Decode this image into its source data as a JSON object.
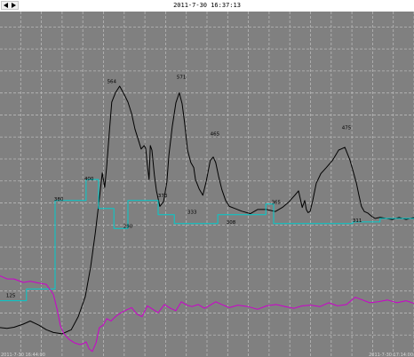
{
  "header": {
    "timestamp": "2011-7-30 16:37:13"
  },
  "chart_data": {
    "type": "line",
    "grid": true,
    "background_color": "#808080",
    "grid_color": "#b8b8b8",
    "xlim": [
      0,
      100
    ],
    "ylim": [
      0,
      100
    ],
    "x_start_label": "2011-7-30 16:44:00",
    "x_end_label": "2011-7-30 17:14:00",
    "series": [
      {
        "color": "#000000",
        "x": [
          0,
          1.7,
          3.4,
          5.6,
          7.3,
          9.4,
          11.2,
          12.9,
          15.0,
          17.2,
          18.9,
          20.6,
          21.9,
          23.0,
          24.0,
          24.7,
          25.3,
          25.8,
          26.4,
          27.0,
          27.9,
          28.9,
          30.0,
          30.9,
          31.8,
          32.6,
          33.3,
          34.1,
          34.8,
          35.2,
          35.6,
          36.0,
          36.3,
          36.7,
          37.3,
          37.8,
          38.6,
          39.5,
          40.3,
          40.8,
          41.6,
          42.5,
          43.3,
          44.0,
          44.6,
          45.3,
          46.1,
          46.8,
          47.2,
          48.1,
          49.0,
          49.8,
          50.8,
          51.5,
          52.1,
          52.8,
          53.6,
          54.5,
          55.4,
          56.7,
          58.4,
          60.5,
          62.2,
          64.4,
          66.5,
          68.2,
          69.7,
          71.2,
          72.1,
          73.0,
          73.6,
          74.0,
          74.4,
          74.9,
          75.5,
          76.4,
          77.5,
          78.8,
          80.3,
          81.8,
          83.3,
          84.5,
          85.4,
          86.1,
          86.7,
          87.3,
          88.0,
          88.8,
          89.7,
          90.6,
          91.8,
          93.3,
          94.8,
          96.4,
          98.1,
          100
        ],
        "y": [
          8.5,
          8.3,
          8.6,
          9.5,
          10.4,
          9.2,
          7.9,
          7.1,
          6.7,
          7.9,
          11.7,
          17.5,
          26.2,
          35.8,
          45.7,
          53.3,
          49.1,
          55.5,
          64.9,
          73.8,
          76.5,
          78.4,
          76.0,
          73.8,
          70.4,
          66.0,
          63.3,
          60.2,
          61.2,
          60.4,
          55.5,
          51.4,
          61.2,
          59.9,
          52.6,
          48.1,
          43.6,
          45.0,
          50.6,
          58.4,
          66.7,
          73.6,
          76.5,
          73.3,
          67.8,
          59.9,
          56.3,
          54.8,
          51.4,
          48.7,
          46.8,
          50.8,
          56.9,
          57.9,
          56.3,
          52.4,
          48.4,
          45.3,
          43.6,
          43.0,
          42.2,
          41.5,
          42.7,
          42.7,
          42.1,
          43.3,
          44.8,
          46.8,
          48.1,
          43.3,
          45.3,
          42.7,
          41.8,
          42.1,
          45.0,
          50.3,
          53.1,
          54.8,
          56.9,
          59.9,
          60.7,
          57.1,
          53.3,
          50.3,
          46.8,
          43.6,
          42.1,
          41.7,
          40.8,
          40.1,
          40.4,
          40.1,
          39.8,
          40.4,
          39.8,
          40.4
        ]
      },
      {
        "color": "#00cccc",
        "x": [
          0,
          6.4,
          6.4,
          13.3,
          13.3,
          20.8,
          20.8,
          23.8,
          23.8,
          27.5,
          27.5,
          30.9,
          30.9,
          38.2,
          38.2,
          42.1,
          42.1,
          52.6,
          52.6,
          64.2,
          64.2,
          66.1,
          66.1,
          85.2,
          85.2,
          91.8,
          91.8,
          100
        ],
        "y": [
          16.3,
          16.3,
          19.7,
          19.7,
          45.3,
          45.3,
          51.4,
          51.4,
          43.0,
          43.0,
          37.2,
          37.2,
          45.3,
          45.3,
          41.2,
          41.2,
          38.6,
          38.6,
          41.2,
          41.2,
          44.3,
          44.3,
          38.6,
          38.6,
          39.1,
          39.1,
          40.1,
          40.1
        ]
      },
      {
        "color": "#cc00cc",
        "x": [
          0,
          1.7,
          3.4,
          5.6,
          7.3,
          9.4,
          11.2,
          12.9,
          13.8,
          14.6,
          15.5,
          16.7,
          18.0,
          19.3,
          20.2,
          20.8,
          21.5,
          22.3,
          23.2,
          24.0,
          24.9,
          25.8,
          26.8,
          27.9,
          29.2,
          30.5,
          31.8,
          33.1,
          34.3,
          35.6,
          36.9,
          38.2,
          39.7,
          41.2,
          42.5,
          43.8,
          45.1,
          46.4,
          47.9,
          49.4,
          50.8,
          52.1,
          53.6,
          55.4,
          57.5,
          59.9,
          62.2,
          64.4,
          66.7,
          68.9,
          71.0,
          73.0,
          75.1,
          77.3,
          79.4,
          81.5,
          83.7,
          85.8,
          87.6,
          89.3,
          91.4,
          93.6,
          95.9,
          98.1,
          100
        ],
        "y": [
          23.5,
          22.6,
          22.6,
          21.6,
          21.9,
          21.4,
          21.0,
          18.1,
          13.8,
          9.0,
          6.6,
          5.1,
          4.1,
          3.6,
          3.9,
          4.4,
          2.4,
          1.6,
          4.1,
          8.5,
          9.2,
          11.1,
          10.4,
          11.7,
          12.8,
          13.6,
          14.3,
          12.4,
          11.7,
          14.8,
          13.8,
          12.8,
          15.2,
          14.1,
          13.4,
          16.0,
          15.0,
          14.6,
          15.2,
          14.1,
          15.0,
          16.0,
          15.2,
          14.3,
          15.0,
          14.6,
          13.8,
          14.8,
          15.2,
          14.6,
          14.1,
          14.8,
          15.0,
          14.6,
          15.7,
          14.8,
          15.2,
          17.3,
          16.5,
          15.7,
          16.0,
          16.5,
          15.7,
          16.3,
          15.5
        ]
      }
    ],
    "annotations": [
      {
        "text": "564",
        "x": 27.0,
        "y": 79.3
      },
      {
        "text": "571",
        "x": 43.8,
        "y": 80.6
      },
      {
        "text": "465",
        "x": 51.9,
        "y": 64.2
      },
      {
        "text": "475",
        "x": 83.7,
        "y": 65.9
      },
      {
        "text": "400",
        "x": 21.5,
        "y": 51.1
      },
      {
        "text": "380",
        "x": 14.2,
        "y": 45.3
      },
      {
        "text": "373",
        "x": 39.3,
        "y": 46.3
      },
      {
        "text": "365",
        "x": 66.7,
        "y": 44.3
      },
      {
        "text": "333",
        "x": 46.4,
        "y": 41.5
      },
      {
        "text": "308",
        "x": 55.8,
        "y": 38.6
      },
      {
        "text": "311",
        "x": 86.3,
        "y": 39.1
      },
      {
        "text": "290",
        "x": 30.9,
        "y": 37.4
      },
      {
        "text": "125",
        "x": 2.6,
        "y": 17.4
      }
    ]
  }
}
